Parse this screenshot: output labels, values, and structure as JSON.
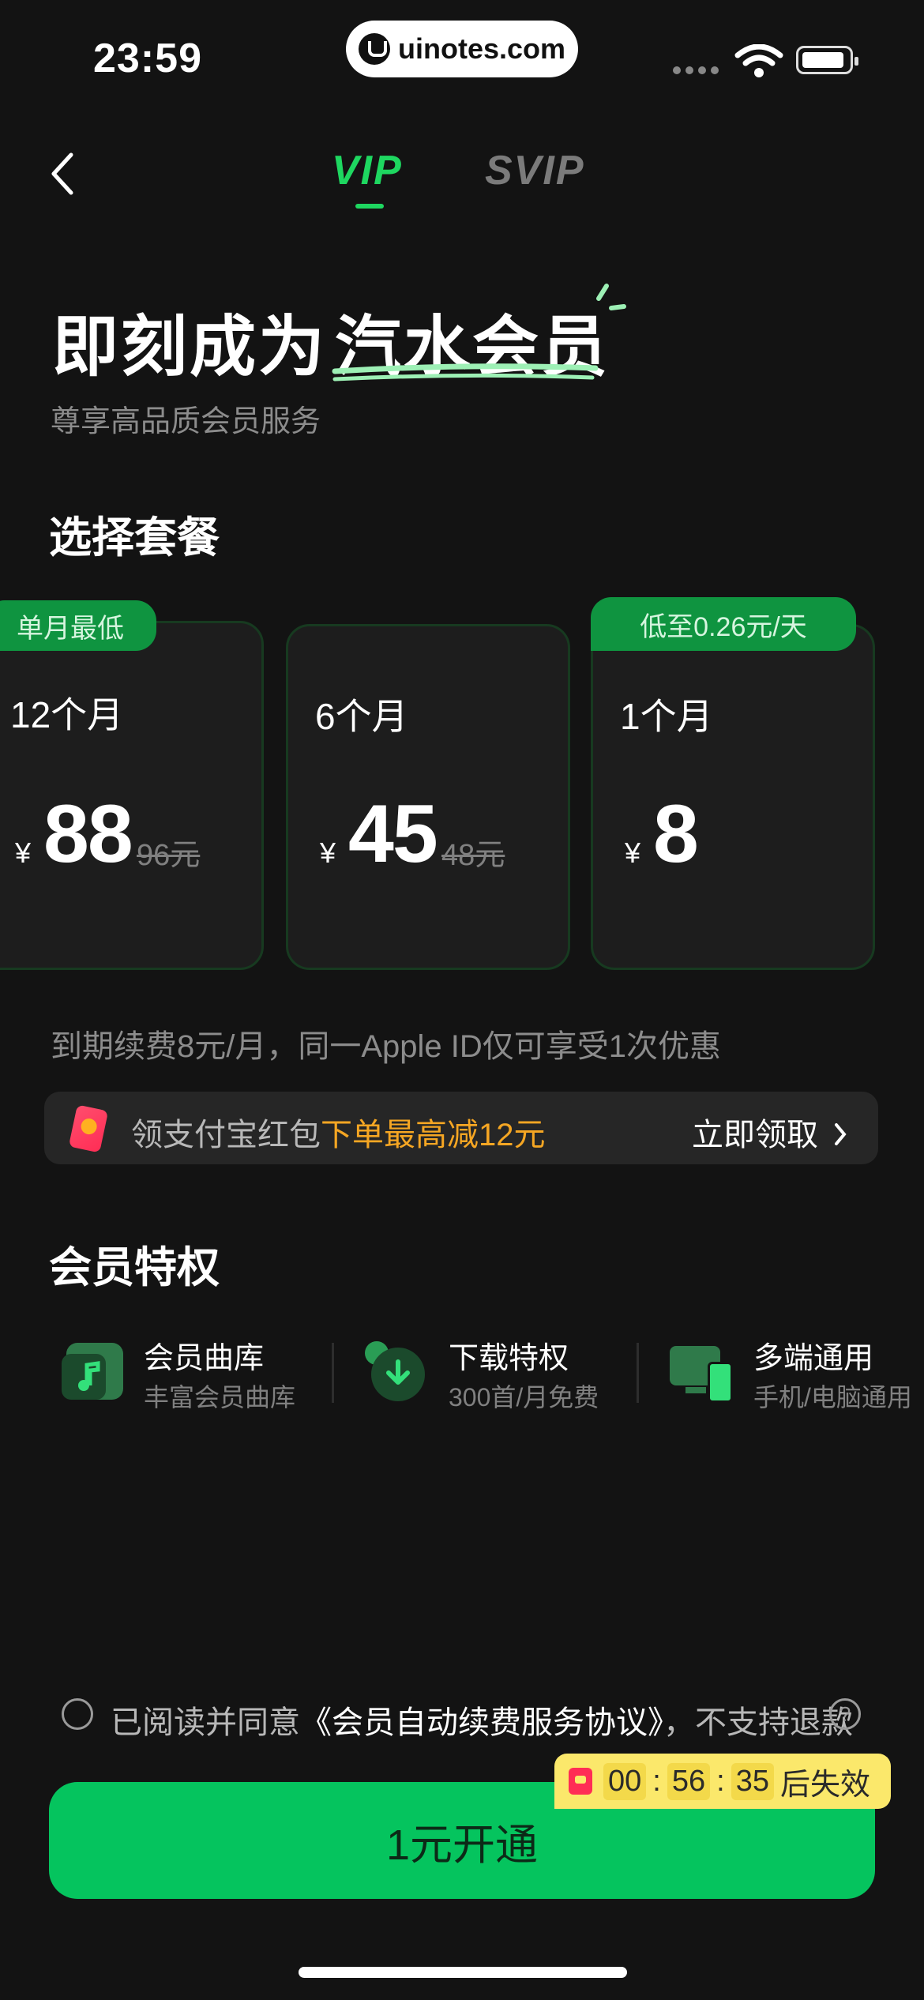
{
  "status_bar": {
    "time": "23:59",
    "site": "uinotes.com"
  },
  "header": {
    "tabs": [
      {
        "label": "VIP",
        "active": true
      },
      {
        "label": "SVIP",
        "active": false
      }
    ]
  },
  "hero": {
    "title_prefix": "即刻成为",
    "title_accent": "汽水会员",
    "subtitle": "尊享高品质会员服务"
  },
  "plans": {
    "section_title": "选择套餐",
    "items": [
      {
        "tag": "单月最低",
        "name": "12个月",
        "currency": "¥",
        "price": "88",
        "original": "96元"
      },
      {
        "tag": "",
        "name": "6个月",
        "currency": "¥",
        "price": "45",
        "original": "48元"
      },
      {
        "tag": "低至0.26元/天",
        "name": "1个月",
        "currency": "¥",
        "price": "8",
        "original": ""
      }
    ],
    "renew_note": "到期续费8元/月，同一Apple ID仅可享受1次优惠"
  },
  "promo": {
    "text": "领支付宝红包",
    "highlight": "下单最高减12元",
    "cta": "立即领取"
  },
  "perks": {
    "section_title": "会员特权",
    "items": [
      {
        "title": "会员曲库",
        "sub": "丰富会员曲库",
        "icon": "music-library-icon"
      },
      {
        "title": "下载特权",
        "sub": "300首/月免费",
        "icon": "download-icon"
      },
      {
        "title": "多端通用",
        "sub": "手机/电脑通用",
        "icon": "multi-device-icon"
      }
    ]
  },
  "footer": {
    "agree_prefix": "已阅读并同意",
    "agree_link": "《会员自动续费服务协议》",
    "agree_suffix": "，不支持退款",
    "help": "?",
    "timer": {
      "h": "00",
      "m": "56",
      "s": "35",
      "sep": ":",
      "suffix": "后失效"
    },
    "cta": "1元开通"
  },
  "colors": {
    "accent": "#1ed760",
    "button": "#05c45e",
    "promo_highlight": "#f5a623",
    "timer_bg": "#fbe86b"
  }
}
